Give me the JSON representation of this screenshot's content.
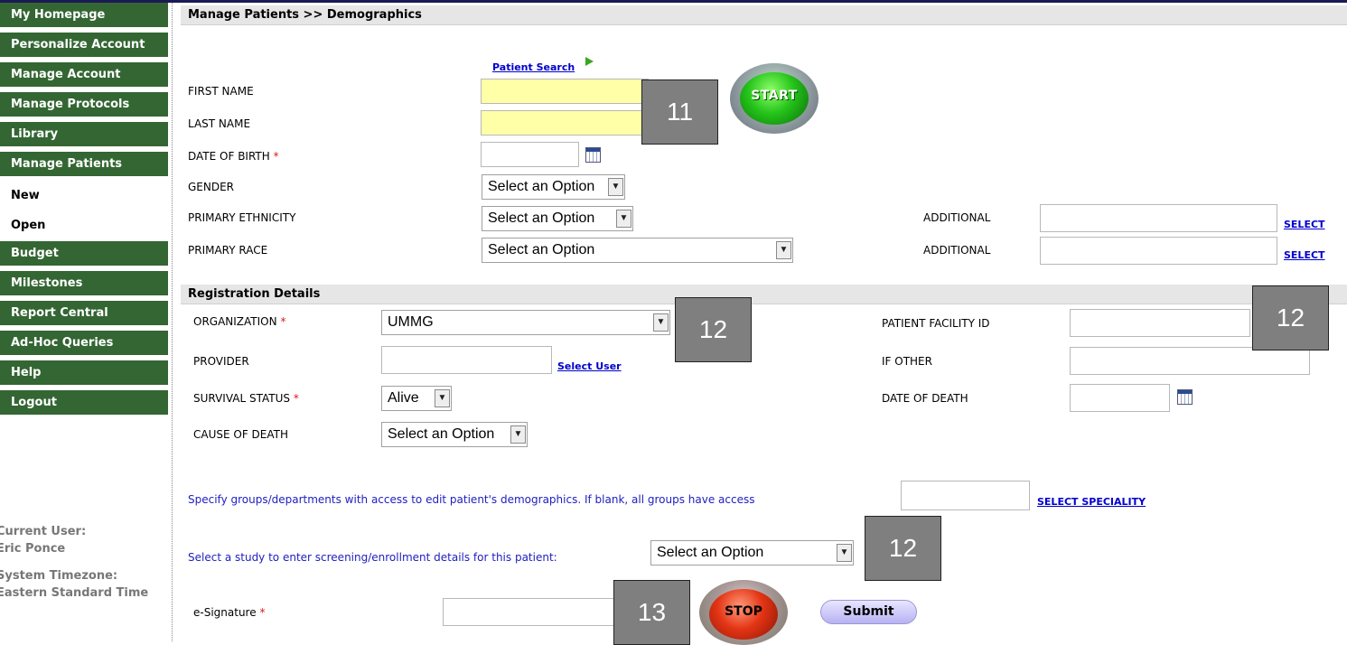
{
  "sidebar": {
    "items": [
      {
        "label": "My Homepage",
        "sub": false
      },
      {
        "label": "Personalize Account",
        "sub": false
      },
      {
        "label": "Manage Account",
        "sub": false
      },
      {
        "label": "Manage Protocols",
        "sub": false
      },
      {
        "label": "Library",
        "sub": false
      },
      {
        "label": "Manage Patients",
        "sub": false
      },
      {
        "label": "New",
        "sub": true
      },
      {
        "label": "Open",
        "sub": true
      },
      {
        "label": "Budget",
        "sub": false
      },
      {
        "label": "Milestones",
        "sub": false
      },
      {
        "label": "Report Central",
        "sub": false
      },
      {
        "label": "Ad-Hoc Queries",
        "sub": false
      },
      {
        "label": "Help",
        "sub": false
      },
      {
        "label": "Logout",
        "sub": false
      }
    ],
    "current_user_label": "Current User:",
    "current_user": "Eric Ponce",
    "timezone_label": "System Timezone:",
    "timezone": "Eastern Standard Time"
  },
  "header": {
    "title": "Manage Patients >> Demographics"
  },
  "demographics": {
    "patient_search_link": "Patient Search",
    "first_name_label": "FIRST NAME",
    "last_name_label": "LAST NAME",
    "dob_label": "DATE OF BIRTH",
    "required_mark": "*",
    "gender_label": "GENDER",
    "gender_value": "Select an Option",
    "ethnicity_label": "PRIMARY ETHNICITY",
    "ethnicity_value": "Select an Option",
    "race_label": "PRIMARY RACE",
    "race_value": "Select an Option",
    "additional_label": "ADDITIONAL",
    "select_link": "SELECT",
    "start_label": "START"
  },
  "registration": {
    "title": "Registration Details",
    "organization_label": "ORGANIZATION",
    "organization_value": "UMMG",
    "provider_label": "PROVIDER",
    "select_user_link": "Select User",
    "survival_label": "SURVIVAL STATUS",
    "survival_value": "Alive",
    "cause_label": "CAUSE OF DEATH",
    "cause_value": "Select an Option",
    "facility_id_label": "PATIENT FACILITY ID",
    "if_other_label": "IF OTHER",
    "date_of_death_label": "DATE OF DEATH"
  },
  "access": {
    "groups_text": "Specify groups/departments with access to edit patient's demographics. If blank, all groups have access",
    "select_speciality_link": "SELECT SPECIALITY",
    "study_text": "Select a study to enter screening/enrollment details for this patient:",
    "study_value": "Select an Option"
  },
  "signature": {
    "label": "e-Signature",
    "stop_label": "STOP",
    "submit_label": "Submit"
  },
  "callouts": [
    "11",
    "12",
    "12",
    "12",
    "13"
  ]
}
